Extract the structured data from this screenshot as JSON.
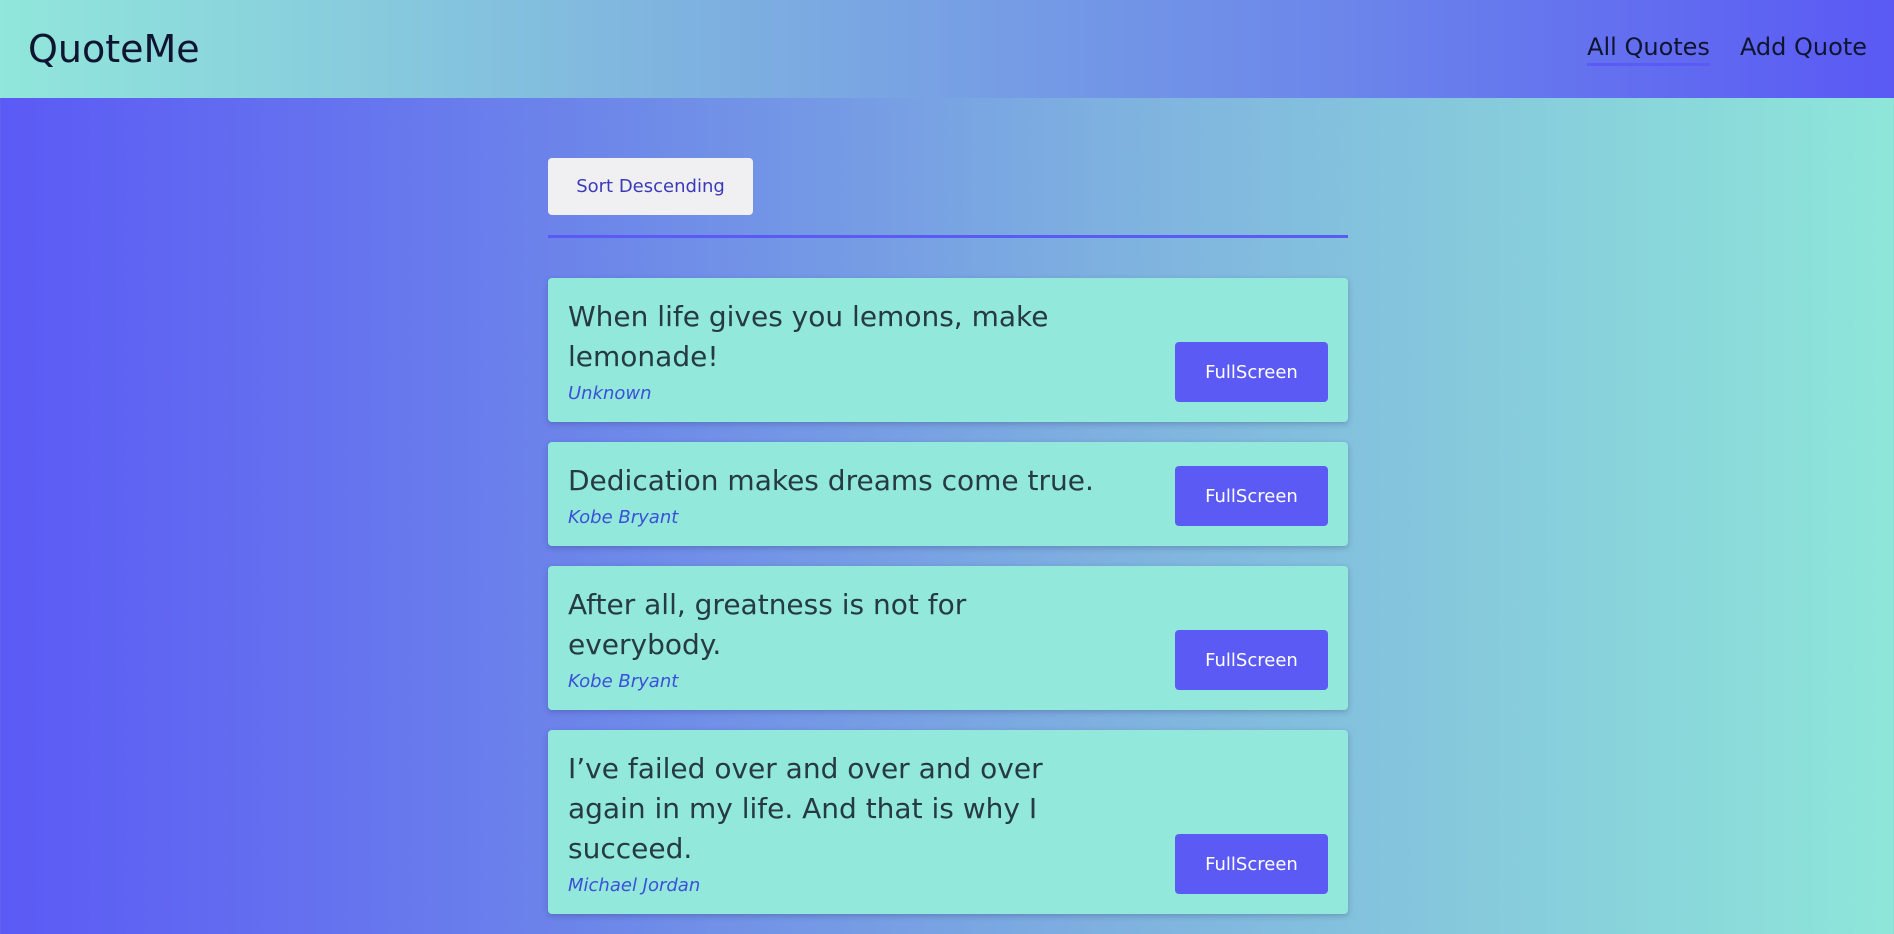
{
  "app": {
    "title": "QuoteMe"
  },
  "nav": {
    "items": [
      {
        "label": "All Quotes",
        "active": true
      },
      {
        "label": "Add Quote",
        "active": false
      }
    ]
  },
  "toolbar": {
    "sort_label": "Sort Descending"
  },
  "quotes": [
    {
      "text": "When life gives you lemons, make lemonade!",
      "author": "Unknown",
      "button_label": "FullScreen"
    },
    {
      "text": "Dedication makes dreams come true.",
      "author": "Kobe Bryant",
      "button_label": "FullScreen"
    },
    {
      "text": "After all, greatness is not for everybody.",
      "author": "Kobe Bryant",
      "button_label": "FullScreen"
    },
    {
      "text": "I’ve failed over and over and over again in my life. And that is why I succeed.",
      "author": "Michael Jordan",
      "button_label": "FullScreen"
    }
  ],
  "colors": {
    "accent": "#5b5af5",
    "card_background": "#92e8da",
    "author_text": "#3c4fd8"
  }
}
